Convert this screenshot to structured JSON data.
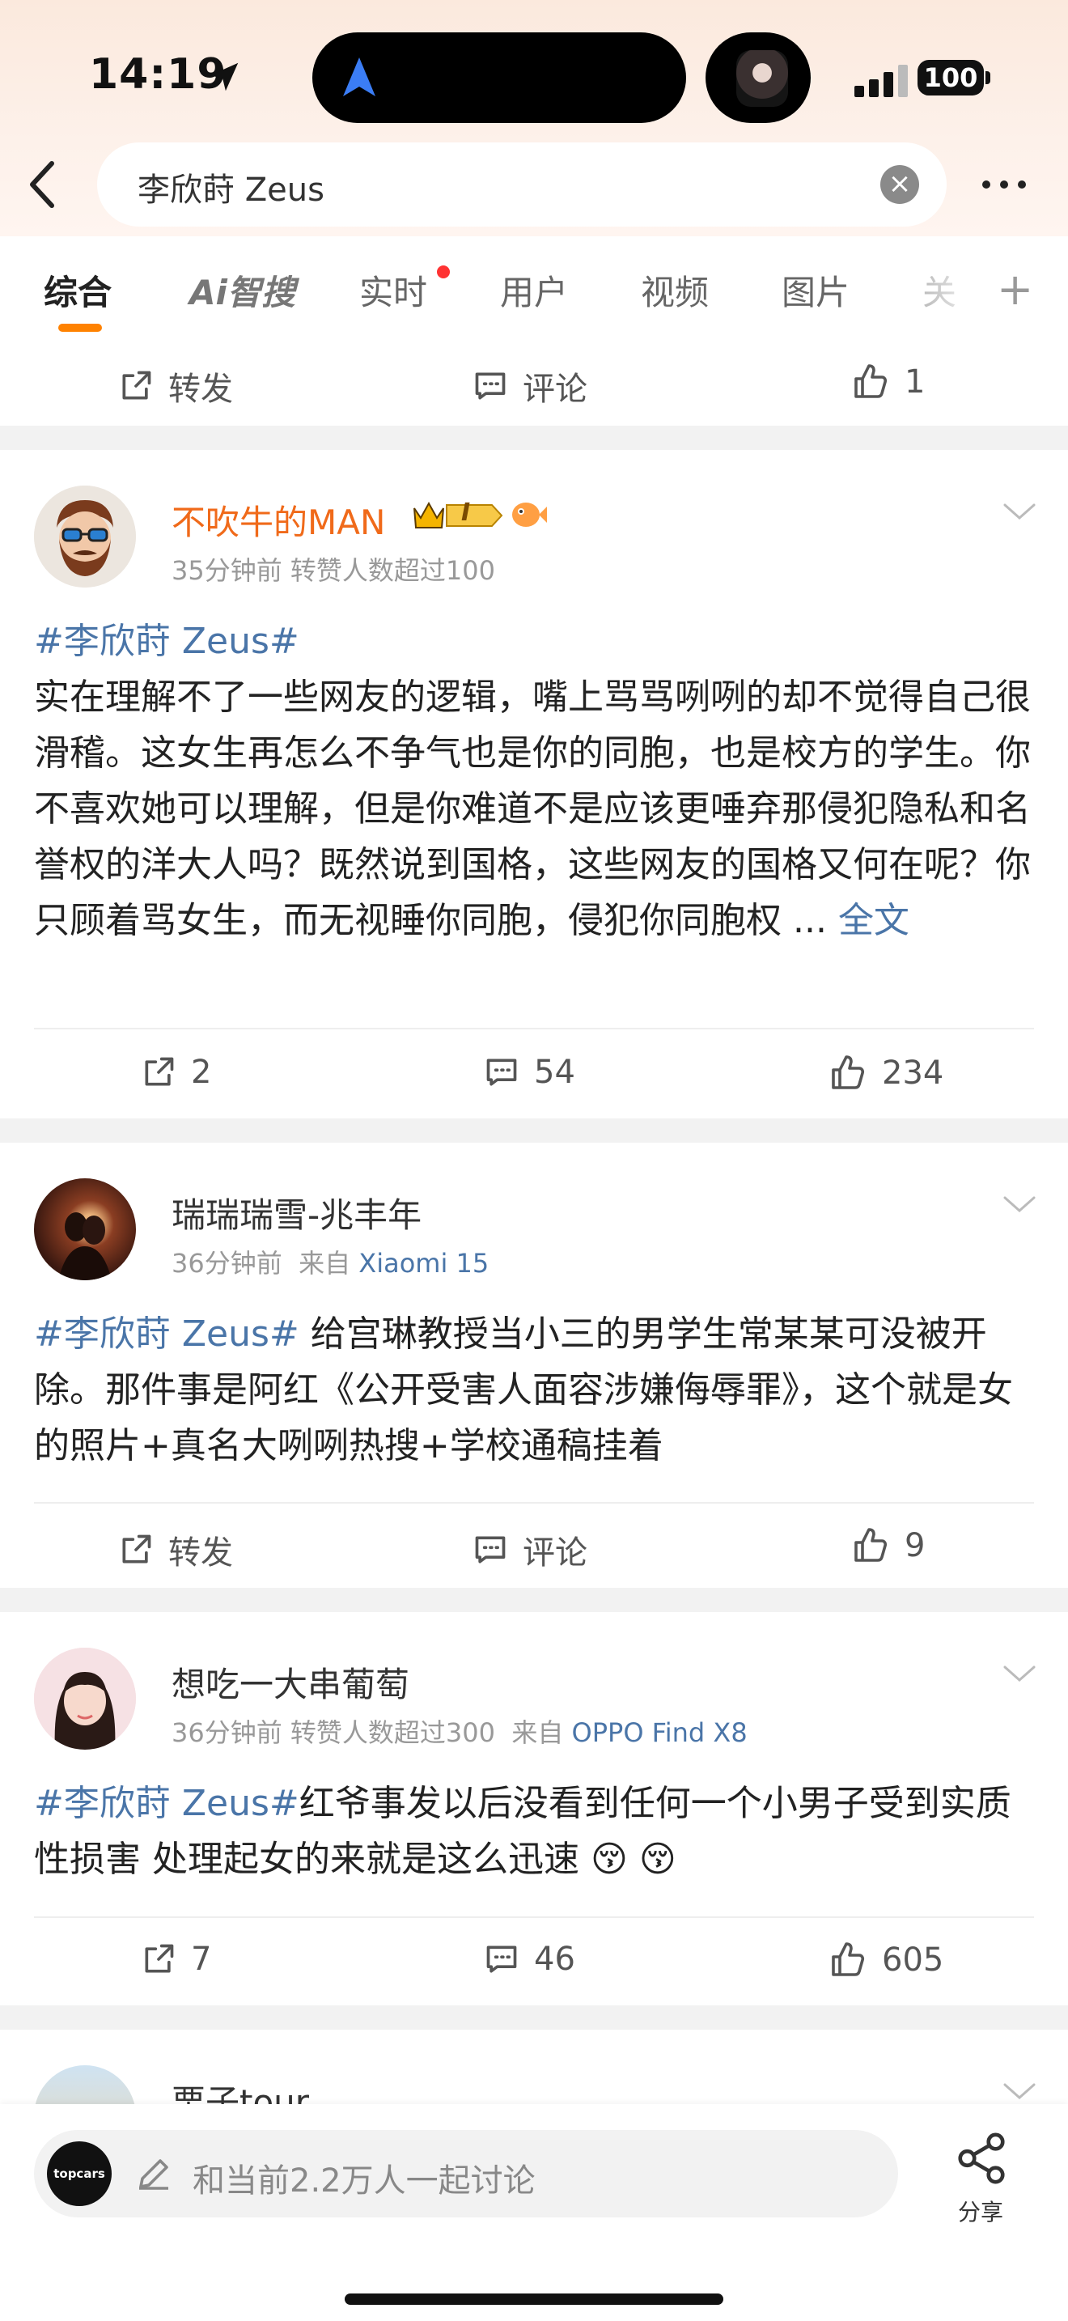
{
  "status_bar": {
    "time": "14:19",
    "battery": "100"
  },
  "search": {
    "query": "李欣莳 Zeus",
    "clear_symbol": "×"
  },
  "tabs": [
    {
      "label": "综合",
      "active": true
    },
    {
      "label": "Ai智搜"
    },
    {
      "label": "实时",
      "has_badge": true
    },
    {
      "label": "用户"
    },
    {
      "label": "视频"
    },
    {
      "label": "图片"
    },
    {
      "label": "关"
    }
  ],
  "plus_symbol": "+",
  "top_actions": {
    "repost": "转发",
    "comment": "评论",
    "like": "1"
  },
  "posts": [
    {
      "author": "不吹牛的MAN",
      "badge": "I",
      "time": "35分钟前",
      "meta_extra": "转赞人数超过100",
      "source_label": "",
      "source": "",
      "topic": "#李欣莳 Zeus#",
      "text": "实在理解不了一些网友的逻辑，嘴上骂骂咧咧的却不觉得自己很滑稽。这女生再怎么不争气也是你的同胞，也是校方的学生。你不喜欢她可以理解，但是你难道不是应该更唾弃那侵犯隐私和名誉权的洋大人吗？既然说到国格，这些网友的国格又何在呢？你只顾着骂女生，而无视睡你同胞，侵犯你同胞权 ... ",
      "read_more": "全文",
      "reposts": "2",
      "comments": "54",
      "likes": "234"
    },
    {
      "author": "瑞瑞瑞雪-兆丰年",
      "time": "36分钟前",
      "meta_extra": "",
      "source_label": "来自",
      "source": "Xiaomi 15",
      "topic": "#李欣莳 Zeus#",
      "text": " 给宫琳教授当小三的男学生常某某可没被开除。那件事是阿红《公开受害人面容涉嫌侮辱罪》，这个就是女的照片+真名大咧咧热搜+学校通稿挂着",
      "reposts": "转发",
      "comments": "评论",
      "likes": "9"
    },
    {
      "author": "想吃一大串葡萄",
      "time": "36分钟前",
      "meta_extra": "转赞人数超过300",
      "source_label": "来自",
      "source": "OPPO Find X8",
      "topic": "#李欣莳 Zeus#",
      "text": "红爷事发以后没看到任何一个小男子受到实质性损害 处理起女的来就是这么迅速",
      "emoji": "😚 😚",
      "reposts": "7",
      "comments": "46",
      "likes": "605"
    },
    {
      "author": "栗子tour"
    }
  ],
  "bottom": {
    "logo_text": "topcars",
    "placeholder": "和当前2.2万人一起讨论",
    "share": "分享"
  },
  "colors": {
    "accent": "#ff8200",
    "topic": "#4a75a8",
    "vip_name": "#f06a1a"
  }
}
